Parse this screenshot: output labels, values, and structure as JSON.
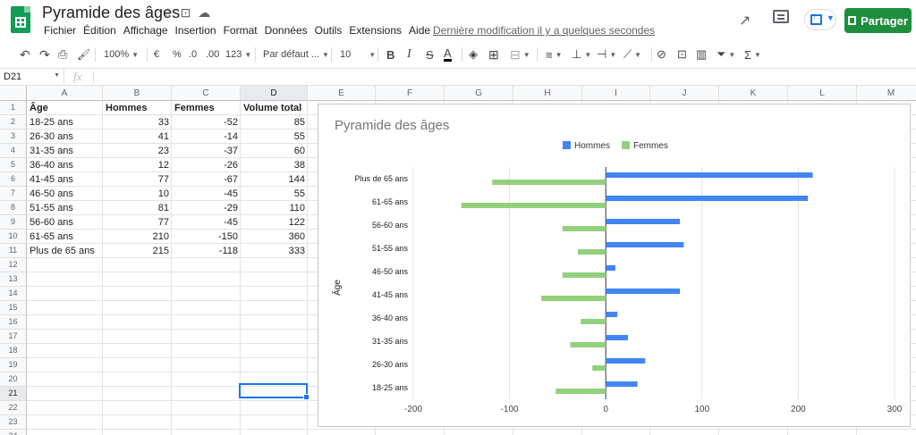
{
  "header": {
    "title": "Pyramide des âges",
    "menu": [
      "Fichier",
      "Édition",
      "Affichage",
      "Insertion",
      "Format",
      "Données",
      "Outils",
      "Extensions",
      "Aide"
    ],
    "last_edit": "Dernière modification il y a quelques secondes",
    "share_label": "Partager",
    "icons": {
      "star": "star-icon",
      "move": "folder-move-icon",
      "cloud": "cloud-status-icon",
      "trend": "trending-icon",
      "comment": "comment-icon",
      "present": "present-icon",
      "lock": "lock-icon"
    }
  },
  "toolbar": {
    "zoom": "100%",
    "currency": "€",
    "percent": "%",
    "dec_less": ".0",
    "dec_more": ".00",
    "more_formats": "123",
    "font": "Par défaut ...",
    "font_size": "10",
    "bold": "B",
    "italic": "I",
    "strike": "S",
    "text_color": "A",
    "sigma": "Σ"
  },
  "formula_bar": {
    "cell_ref": "D21",
    "fx": "fx",
    "content": ""
  },
  "grid": {
    "columns": [
      "A",
      "B",
      "C",
      "D",
      "E",
      "F",
      "G",
      "H",
      "I",
      "J",
      "K",
      "L",
      "M"
    ],
    "rows": [
      "1",
      "2",
      "3",
      "4",
      "5",
      "6",
      "7",
      "8",
      "9",
      "10",
      "11",
      "12",
      "13",
      "14",
      "15",
      "16",
      "17",
      "18",
      "19",
      "20",
      "21",
      "22",
      "23",
      "24"
    ],
    "selected_col": "D",
    "selected_row": "21",
    "header_row": [
      "Âge",
      "Hommes",
      "Femmes",
      "Volume total"
    ],
    "data": [
      [
        "18-25 ans",
        "33",
        "-52",
        "85"
      ],
      [
        "26-30 ans",
        "41",
        "-14",
        "55"
      ],
      [
        "31-35 ans",
        "23",
        "-37",
        "60"
      ],
      [
        "36-40 ans",
        "12",
        "-26",
        "38"
      ],
      [
        "41-45 ans",
        "77",
        "-67",
        "144"
      ],
      [
        "46-50 ans",
        "10",
        "-45",
        "55"
      ],
      [
        "51-55 ans",
        "81",
        "-29",
        "110"
      ],
      [
        "56-60 ans",
        "77",
        "-45",
        "122"
      ],
      [
        "61-65 ans",
        "210",
        "-150",
        "360"
      ],
      [
        "Plus de 65 ans",
        "215",
        "-118",
        "333"
      ]
    ]
  },
  "chart_data": {
    "type": "bar",
    "orientation": "horizontal",
    "title": "Pyramide des âges",
    "ylabel": "Âge",
    "xlabel": "",
    "categories": [
      "Plus de 65 ans",
      "61-65 ans",
      "56-60 ans",
      "51-55 ans",
      "46-50 ans",
      "41-45 ans",
      "36-40 ans",
      "31-35 ans",
      "26-30 ans",
      "18-25 ans"
    ],
    "series": [
      {
        "name": "Hommes",
        "color": "#4285f4",
        "values": [
          215,
          210,
          77,
          81,
          10,
          77,
          12,
          23,
          41,
          33
        ]
      },
      {
        "name": "Femmes",
        "color": "#93d07e",
        "values": [
          -118,
          -150,
          -45,
          -29,
          -45,
          -67,
          -26,
          -37,
          -14,
          -52
        ]
      }
    ],
    "xlim": [
      -200,
      300
    ],
    "xticks": [
      "-200",
      "-100",
      "0",
      "100",
      "200",
      "300"
    ],
    "grid": true,
    "legend_position": "top"
  }
}
